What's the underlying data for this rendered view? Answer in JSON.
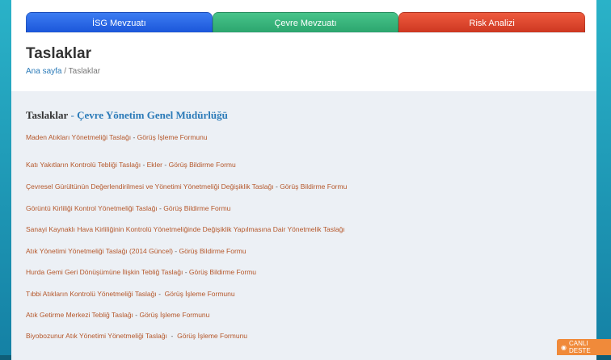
{
  "tabs": [
    {
      "label": "İSG Mevzuatı"
    },
    {
      "label": "Çevre Mevzuatı"
    },
    {
      "label": "Risk Analizi"
    }
  ],
  "page_title": "Taslaklar",
  "breadcrumb": {
    "home": "Ana sayfa",
    "separator": " / ",
    "current": "Taslaklar"
  },
  "section": {
    "title": "Taslaklar",
    "separator": " - ",
    "org": "Çevre Yönetim Genel Müdürlüğü"
  },
  "documents": [
    {
      "title": "Maden Atıkları Yönetmeliği Taslağı",
      "sep": " - ",
      "form": "Görüş İşleme Formunu"
    },
    {
      "title": "Katı Yakıtların Kontrolü Tebliği Taslağı",
      "sep": " - ",
      "extra": "Ekler",
      "sep2": " - ",
      "form": "Görüş Bildirme Formu"
    },
    {
      "title": "Çevresel Gürültünün Değerlendirilmesi ve Yönetimi Yönetmeliği Değişiklik Taslağı",
      "sep": " - ",
      "form": "Görüş Bildirme Formu"
    },
    {
      "title": "Görüntü Kirliliği Kontrol Yönetmeliği Taslağı",
      "sep": " - ",
      "form": "Görüş Bildirme Formu"
    },
    {
      "title": "Sanayi Kaynaklı Hava Kirliliğinin Kontrolü Yönetmeliğinde Değişiklik Yapılmasına Dair Yönetmelik Taslağı"
    },
    {
      "title": "Atık Yönetimi Yönetmeliği Taslağı (2014 Güncel)",
      "sep": " - ",
      "form": "Görüş Bildirme Formu"
    },
    {
      "title": "Hurda Gemi Geri Dönüşümüne İlişkin Tebliğ Taslağı",
      "sep": " - ",
      "form": "Görüş Bildirme Formu"
    },
    {
      "title": "Tıbbi Atıkların Kontrolü Yönetmeliği Taslağı",
      "sep": " -  ",
      "form": "Görüş İşleme Formunu"
    },
    {
      "title": "Atık Getirme Merkezi Tebliğ Taslağı",
      "sep": " - ",
      "form": "Görüş İşleme Formunu"
    },
    {
      "title": "Biyobozunur Atık Yönetimi Yönetmeliği Taslağı",
      "sep": "  -  ",
      "form": "Görüş İşleme Formunu"
    }
  ],
  "live_support": {
    "label": "CANLI DESTE",
    "icon": "chat-icon"
  }
}
